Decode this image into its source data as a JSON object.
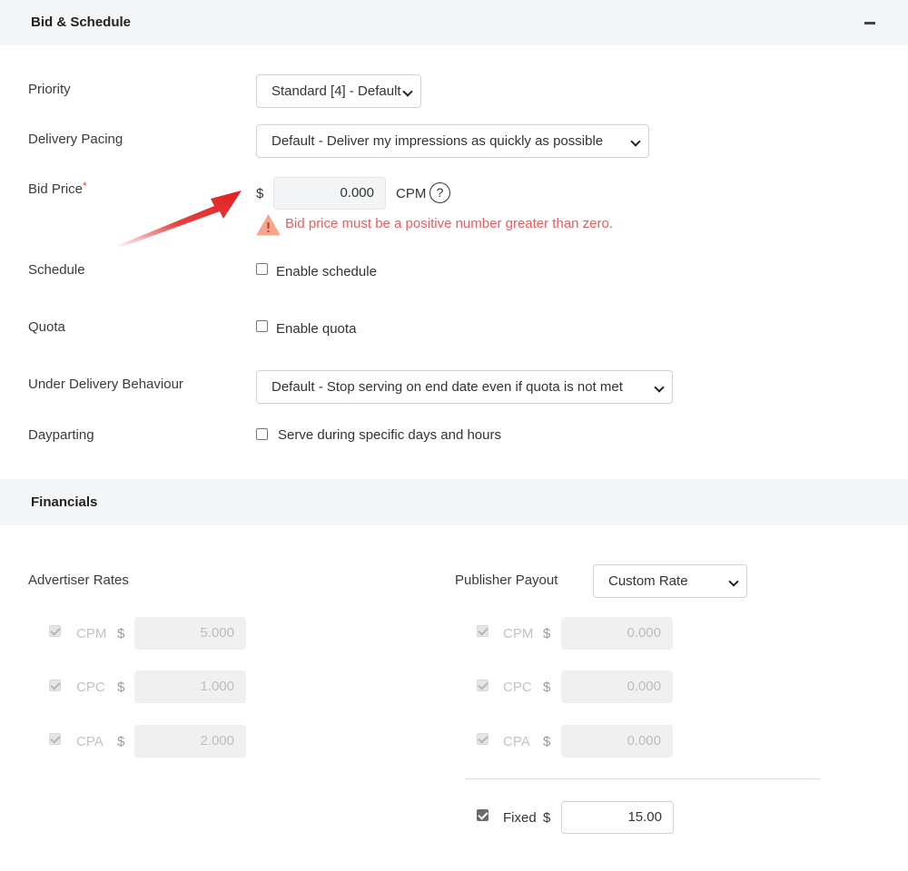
{
  "bid_schedule": {
    "title": "Bid & Schedule",
    "priority": {
      "label": "Priority",
      "value": "Standard [4] - Default"
    },
    "delivery_pacing": {
      "label": "Delivery Pacing",
      "value": "Default - Deliver my impressions as quickly as possible"
    },
    "bid_price": {
      "label": "Bid Price",
      "required_mark": "*",
      "currency": "$",
      "value": "0.000",
      "unit": "CPM",
      "help": "?",
      "error": "Bid price must be a positive number greater than zero."
    },
    "schedule": {
      "label": "Schedule",
      "checkbox_label": "Enable schedule"
    },
    "quota": {
      "label": "Quota",
      "checkbox_label": "Enable quota"
    },
    "under_delivery": {
      "label": "Under Delivery Behaviour",
      "value": "Default - Stop serving on end date even if quota is not met"
    },
    "dayparting": {
      "label": "Dayparting",
      "checkbox_label": "Serve during specific days and hours"
    }
  },
  "financials": {
    "title": "Financials",
    "advertiser": {
      "label": "Advertiser Rates",
      "rates": [
        {
          "type": "CPM",
          "currency": "$",
          "value": "5.000"
        },
        {
          "type": "CPC",
          "currency": "$",
          "value": "1.000"
        },
        {
          "type": "CPA",
          "currency": "$",
          "value": "2.000"
        }
      ]
    },
    "publisher": {
      "label": "Publisher Payout",
      "mode": "Custom Rate",
      "rates": [
        {
          "type": "CPM",
          "currency": "$",
          "value": "0.000"
        },
        {
          "type": "CPC",
          "currency": "$",
          "value": "0.000"
        },
        {
          "type": "CPA",
          "currency": "$",
          "value": "0.000"
        }
      ],
      "fixed": {
        "label": "Fixed",
        "currency": "$",
        "value": "15.00"
      }
    }
  },
  "colors": {
    "error": "#e85d5d",
    "arrow": "#e02020",
    "header_bg": "#f4f5f6"
  }
}
